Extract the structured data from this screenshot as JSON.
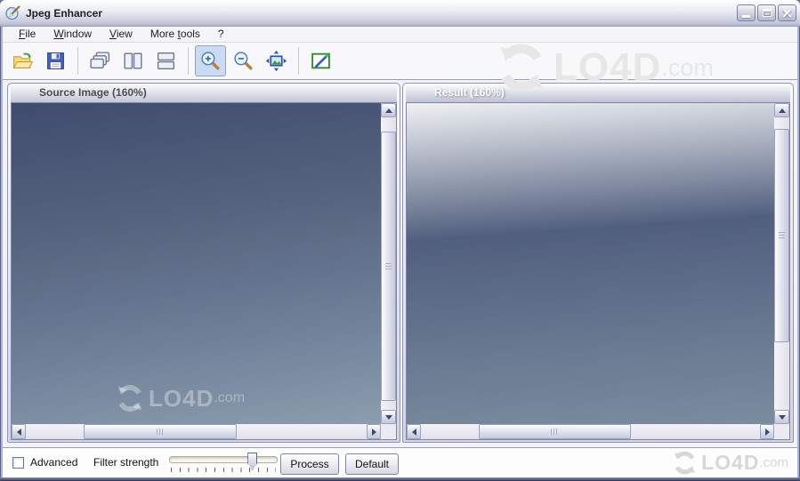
{
  "window": {
    "title": "Jpeg Enhancer",
    "controls": [
      {
        "name": "minimize"
      },
      {
        "name": "maximize"
      },
      {
        "name": "close"
      }
    ]
  },
  "menu": {
    "items": [
      {
        "pre": "",
        "key": "F",
        "post": "ile"
      },
      {
        "pre": "",
        "key": "W",
        "post": "indow"
      },
      {
        "pre": "",
        "key": "V",
        "post": "iew"
      },
      {
        "pre": "More ",
        "key": "t",
        "post": "ools"
      },
      {
        "pre": "?",
        "key": "",
        "post": ""
      }
    ]
  },
  "toolbar": {
    "buttons": [
      {
        "name": "open",
        "icon": "folder-open-icon"
      },
      {
        "name": "save",
        "icon": "floppy-disk-icon"
      },
      {
        "name": "cascade-windows",
        "icon": "cascade-windows-icon"
      },
      {
        "name": "tile-vertical",
        "icon": "tile-vertical-icon"
      },
      {
        "name": "tile-horizontal",
        "icon": "tile-horizontal-icon"
      },
      {
        "name": "zoom-in",
        "icon": "zoom-in-icon"
      },
      {
        "name": "zoom-out",
        "icon": "zoom-out-icon"
      },
      {
        "name": "fit-to-window",
        "icon": "fit-image-icon"
      },
      {
        "name": "enhance",
        "icon": "enhance-image-icon"
      }
    ],
    "active_button": "zoom-in"
  },
  "panels": {
    "source": {
      "title": "Source Image (160%)",
      "zoom_level": "160%"
    },
    "result": {
      "title": "Result (160%)",
      "zoom_level": "160%"
    }
  },
  "bottom_bar": {
    "advanced_checkbox": {
      "label": "Advanced",
      "checked": false
    },
    "filter_strength_label": "Filter strength",
    "slider": {
      "percent": 76
    },
    "process_button": "Process",
    "default_button": "Default"
  },
  "watermark": {
    "brand": "LO4D",
    "suffix": ".com"
  },
  "colors": {
    "active_toolbar_bg": "#ccd9f2",
    "active_toolbar_border": "#8ba3cc",
    "sky_top": "#404c6e",
    "sky_bottom": "#8c9dae",
    "sky_top_result": "#3c4a6e",
    "sky_bottom_result": "#7b8c9f",
    "titlebar_text": "#1e1e28",
    "window_border_dark": "#2f3457"
  }
}
